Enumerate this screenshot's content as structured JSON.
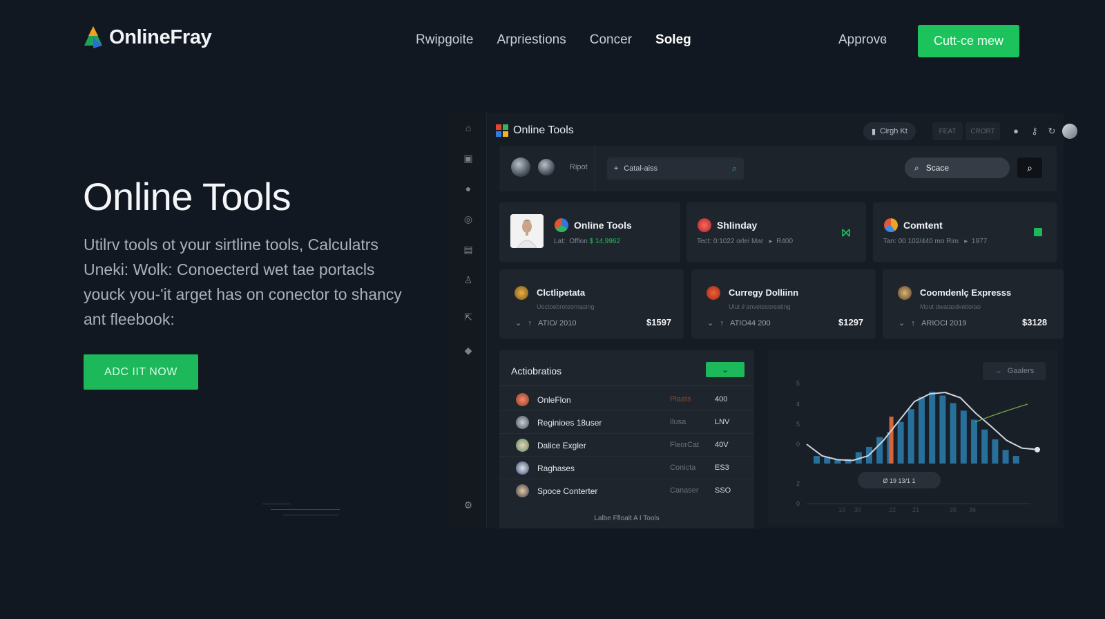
{
  "nav": {
    "brand": "OnlineFray",
    "links": [
      "Rwipgoite",
      "Arpriestions",
      "Concer",
      "Soleg"
    ],
    "approve": "Approvɞ",
    "cta": "Cutt-ce mew"
  },
  "hero": {
    "title": "Online Tools",
    "description": "Utilrv tools ot your sirtline tools, Calculatrs Uneki: Wolk: Conoecterd wet tae portacls youck you-'it arget has on conector to shancy ant fleebook:",
    "cta": "ADC IIT NOW"
  },
  "app": {
    "title": "Online Tools",
    "header_pill": "Cirgh Kt",
    "header_chips": [
      "FEAT",
      "CRORT"
    ],
    "toolbar": {
      "label": "Ripot",
      "location_value": "Catal-aiss",
      "search_placeholder": "Scace"
    },
    "cards_top": [
      {
        "title": "Online Tools",
        "sub_prefix": "Lat:",
        "sub_mid": "Offlon",
        "sub_highlight": "$ 14,9962"
      },
      {
        "title": "Shlinday",
        "sub_prefix": "Tect:",
        "sub_mid": "0:1022 orlei Mar",
        "sub_highlight": "",
        "sub_tail": "R400"
      },
      {
        "title": "Comtent",
        "sub_prefix": "Tan:",
        "sub_mid": "00 102/440 mo Rim",
        "sub_highlight": "",
        "sub_tail": "1977"
      }
    ],
    "cards_bottom": [
      {
        "title": "Clctlipetata",
        "sub": "Uectoebroteornasing",
        "meta": "ATIO/ 2010",
        "price": "$1597"
      },
      {
        "title": "Curregy Dolliinn",
        "sub": "Ulut ∂ anvetesoreating",
        "meta": "ATIO44 200",
        "price": "$1297"
      },
      {
        "title": "Coomdenlç Expresss",
        "sub": "Mout dwatasdvetiorao",
        "meta": "ARIOCI 2019",
        "price": "$3128"
      }
    ],
    "activity": {
      "title": "Actiobratios",
      "footer": "Lalbe Ffloalt A I Tools",
      "rows": [
        {
          "name": "OnleFlon",
          "type": "Plaats",
          "value": "400"
        },
        {
          "name": "Reginioes 18user",
          "type": "Ilusa",
          "value": "LNV"
        },
        {
          "name": "Dalice Exgler",
          "type": "FleorCat",
          "value": "40V"
        },
        {
          "name": "Raghases",
          "type": "Conicta",
          "value": "ES3"
        },
        {
          "name": "Spoce Conterter",
          "type": "Canaser",
          "value": "SSO"
        }
      ]
    },
    "chart": {
      "button": "Gaalers",
      "y_ticks": [
        "5",
        "4",
        "5",
        "0",
        "2",
        "0"
      ],
      "x_ticks": [
        "10",
        "30",
        "22",
        "21",
        "35",
        "36"
      ],
      "badge": "Ø 19  13/1 1",
      "bars_blue": [
        0.1,
        0.08,
        0.05,
        0.06,
        0.15,
        0.22,
        0.35,
        0.42,
        0.55,
        0.72,
        0.88,
        0.95,
        0.9,
        0.8,
        0.7,
        0.58,
        0.45,
        0.32,
        0.18,
        0.1
      ],
      "bars_orange": [
        0.0,
        0.0,
        0.0,
        0.0,
        0.0,
        0.0,
        0.0,
        0.0,
        0.62,
        0.0,
        0.0,
        0.0,
        0.0,
        0.0,
        0.0,
        0.0,
        0.0,
        0.0,
        0.0,
        0.0
      ],
      "line": [
        0.25,
        0.1,
        0.05,
        0.04,
        0.1,
        0.3,
        0.55,
        0.8,
        0.9,
        0.92,
        0.85,
        0.65,
        0.48,
        0.3,
        0.2,
        0.18
      ]
    }
  }
}
